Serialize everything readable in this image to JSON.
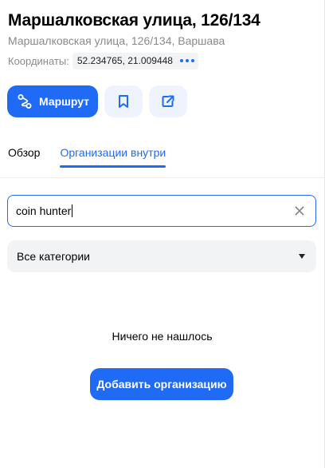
{
  "place": {
    "title": "Маршалковская улица, 126/134",
    "address": "Маршалковская улица, 126/134, Варшава",
    "coords_label": "Координаты:",
    "coords_value": "52.234765, 21.009448",
    "more_icon": "more-dots-icon"
  },
  "actions": {
    "route_label": "Маршрут",
    "route_icon": "route-icon",
    "bookmark_icon": "bookmark-icon",
    "share_icon": "share-icon"
  },
  "tabs": [
    {
      "label": "Обзор",
      "active": false
    },
    {
      "label": "Организации внутри",
      "active": true
    }
  ],
  "search": {
    "value": "coin hunter",
    "clear_icon": "close-icon"
  },
  "category_select": {
    "value": "Все категории",
    "icon": "caret-down-icon"
  },
  "results": {
    "empty_message": "Ничего не нашлось",
    "add_button_label": "Добавить организацию"
  },
  "colors": {
    "accent": "#1f6bf5",
    "muted_text": "#8a8a8a",
    "field_bg": "#f2f3f5",
    "icon_button_bg": "#eef3fe"
  }
}
